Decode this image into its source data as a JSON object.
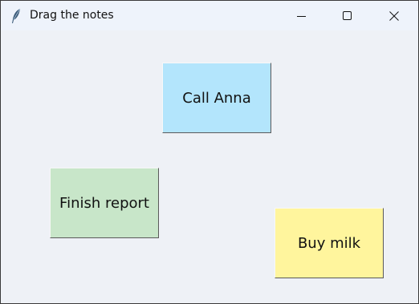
{
  "window": {
    "title": "Drag the notes",
    "icon": "feather-icon",
    "controls": {
      "minimize": "minimize-icon",
      "maximize": "maximize-icon",
      "close": "close-icon"
    }
  },
  "notes": [
    {
      "text": "Call Anna",
      "color": "#b3e5fc"
    },
    {
      "text": "Finish report",
      "color": "#c8e6c9"
    },
    {
      "text": "Buy milk",
      "color": "#fff59d"
    }
  ]
}
